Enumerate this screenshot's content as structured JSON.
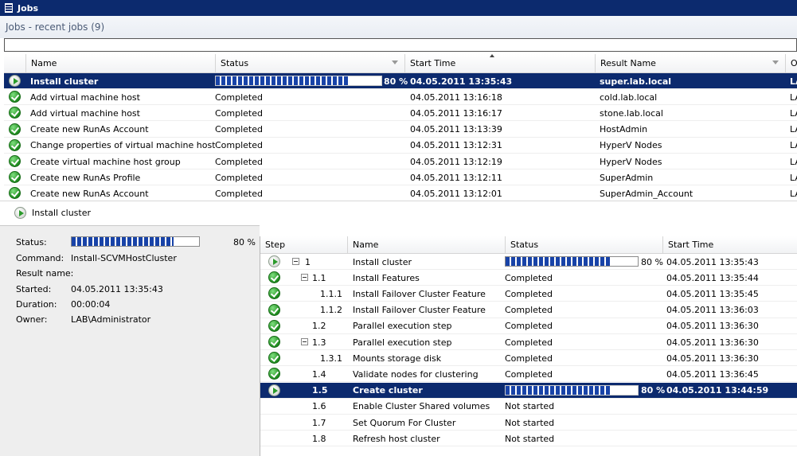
{
  "window": {
    "title": "Jobs"
  },
  "header": {
    "title": "Jobs - recent jobs (9)"
  },
  "jobs_grid": {
    "columns": [
      {
        "name": "icon",
        "label": ""
      },
      {
        "name": "name",
        "label": "Name"
      },
      {
        "name": "status",
        "label": "Status"
      },
      {
        "name": "start-time",
        "label": "Start Time"
      },
      {
        "name": "result-name",
        "label": "Result Name"
      },
      {
        "name": "owner",
        "label": "Ow"
      }
    ],
    "rows": [
      {
        "icon": "play-icon",
        "name": "Install cluster",
        "status": "80 %",
        "progress": 80,
        "start": "04.05.2011 13:35:43",
        "result": "super.lab.local",
        "owner": "LA"
      },
      {
        "icon": "check-icon",
        "name": "Add virtual machine host",
        "status": "Completed",
        "start": "04.05.2011 13:16:18",
        "result": "cold.lab.local",
        "owner": "LA"
      },
      {
        "icon": "check-icon",
        "name": "Add virtual machine host",
        "status": "Completed",
        "start": "04.05.2011 13:16:17",
        "result": "stone.lab.local",
        "owner": "LA"
      },
      {
        "icon": "check-icon",
        "name": "Create new RunAs Account",
        "status": "Completed",
        "start": "04.05.2011 13:13:39",
        "result": "HostAdmin",
        "owner": "LA"
      },
      {
        "icon": "check-icon",
        "name": "Change properties of virtual machine host gr...",
        "status": "Completed",
        "start": "04.05.2011 13:12:31",
        "result": "HyperV Nodes",
        "owner": "LA"
      },
      {
        "icon": "check-icon",
        "name": "Create virtual machine host group",
        "status": "Completed",
        "start": "04.05.2011 13:12:19",
        "result": "HyperV Nodes",
        "owner": "LA"
      },
      {
        "icon": "check-icon",
        "name": "Create new RunAs Profile",
        "status": "Completed",
        "start": "04.05.2011 13:12:11",
        "result": "SuperAdmin",
        "owner": "LA"
      },
      {
        "icon": "check-icon",
        "name": "Create new RunAs Account",
        "status": "Completed",
        "start": "04.05.2011 13:12:01",
        "result": "SuperAdmin_Account",
        "owner": "LA"
      }
    ]
  },
  "detail": {
    "title": "Install cluster",
    "icon": "play-icon",
    "properties": {
      "status_label": "Status:",
      "status_value": "80 %",
      "status_progress": 80,
      "command_label": "Command:",
      "command_value": "Install-SCVMHostCluster",
      "result_label": "Result name:",
      "result_value": "",
      "started_label": "Started:",
      "started_value": "04.05.2011 13:35:43",
      "duration_label": "Duration:",
      "duration_value": "00:00:04",
      "owner_label": "Owner:",
      "owner_value": "LAB\\Administrator"
    }
  },
  "steps_grid": {
    "columns": [
      {
        "name": "step",
        "label": "Step"
      },
      {
        "name": "name",
        "label": "Name"
      },
      {
        "name": "status",
        "label": "Status"
      },
      {
        "name": "start-time",
        "label": "Start Time"
      }
    ],
    "rows": [
      {
        "icon": "play-icon",
        "step": "1",
        "level": 0,
        "expander": true,
        "name": "Install cluster",
        "status": "80 %",
        "progress": 80,
        "start": "04.05.2011 13:35:43"
      },
      {
        "icon": "check-icon",
        "step": "1.1",
        "level": 1,
        "expander": true,
        "name": "Install Features",
        "status": "Completed",
        "start": "04.05.2011 13:35:44"
      },
      {
        "icon": "check-icon",
        "step": "1.1.1",
        "level": 2,
        "expander": false,
        "name": "Install Failover Cluster Feature",
        "status": "Completed",
        "start": "04.05.2011 13:35:45"
      },
      {
        "icon": "check-icon",
        "step": "1.1.2",
        "level": 2,
        "expander": false,
        "name": "Install Failover Cluster Feature",
        "status": "Completed",
        "start": "04.05.2011 13:36:03"
      },
      {
        "icon": "check-icon",
        "step": "1.2",
        "level": 1,
        "expander": false,
        "name": "Parallel execution step",
        "status": "Completed",
        "start": "04.05.2011 13:36:30"
      },
      {
        "icon": "check-icon",
        "step": "1.3",
        "level": 1,
        "expander": true,
        "name": "Parallel execution step",
        "status": "Completed",
        "start": "04.05.2011 13:36:30"
      },
      {
        "icon": "check-icon",
        "step": "1.3.1",
        "level": 2,
        "expander": false,
        "name": "Mounts storage disk",
        "status": "Completed",
        "start": "04.05.2011 13:36:30"
      },
      {
        "icon": "check-icon",
        "step": "1.4",
        "level": 1,
        "expander": false,
        "name": "Validate nodes for clustering",
        "status": "Completed",
        "start": "04.05.2011 13:36:45"
      },
      {
        "icon": "play-icon",
        "step": "1.5",
        "level": 1,
        "expander": false,
        "name": "Create cluster",
        "status": "80 %",
        "progress": 80,
        "start": "04.05.2011 13:44:59",
        "selected": true
      },
      {
        "icon": "",
        "step": "1.6",
        "level": 1,
        "expander": false,
        "name": "Enable Cluster Shared volumes",
        "status": "Not started",
        "start": ""
      },
      {
        "icon": "",
        "step": "1.7",
        "level": 1,
        "expander": false,
        "name": "Set Quorum For Cluster",
        "status": "Not started",
        "start": ""
      },
      {
        "icon": "",
        "step": "1.8",
        "level": 1,
        "expander": false,
        "name": "Refresh host cluster",
        "status": "Not started",
        "start": ""
      }
    ]
  },
  "colors": {
    "selection": "#0c2a6e",
    "progress": "#1843a8",
    "success": "#1e8a1e"
  }
}
